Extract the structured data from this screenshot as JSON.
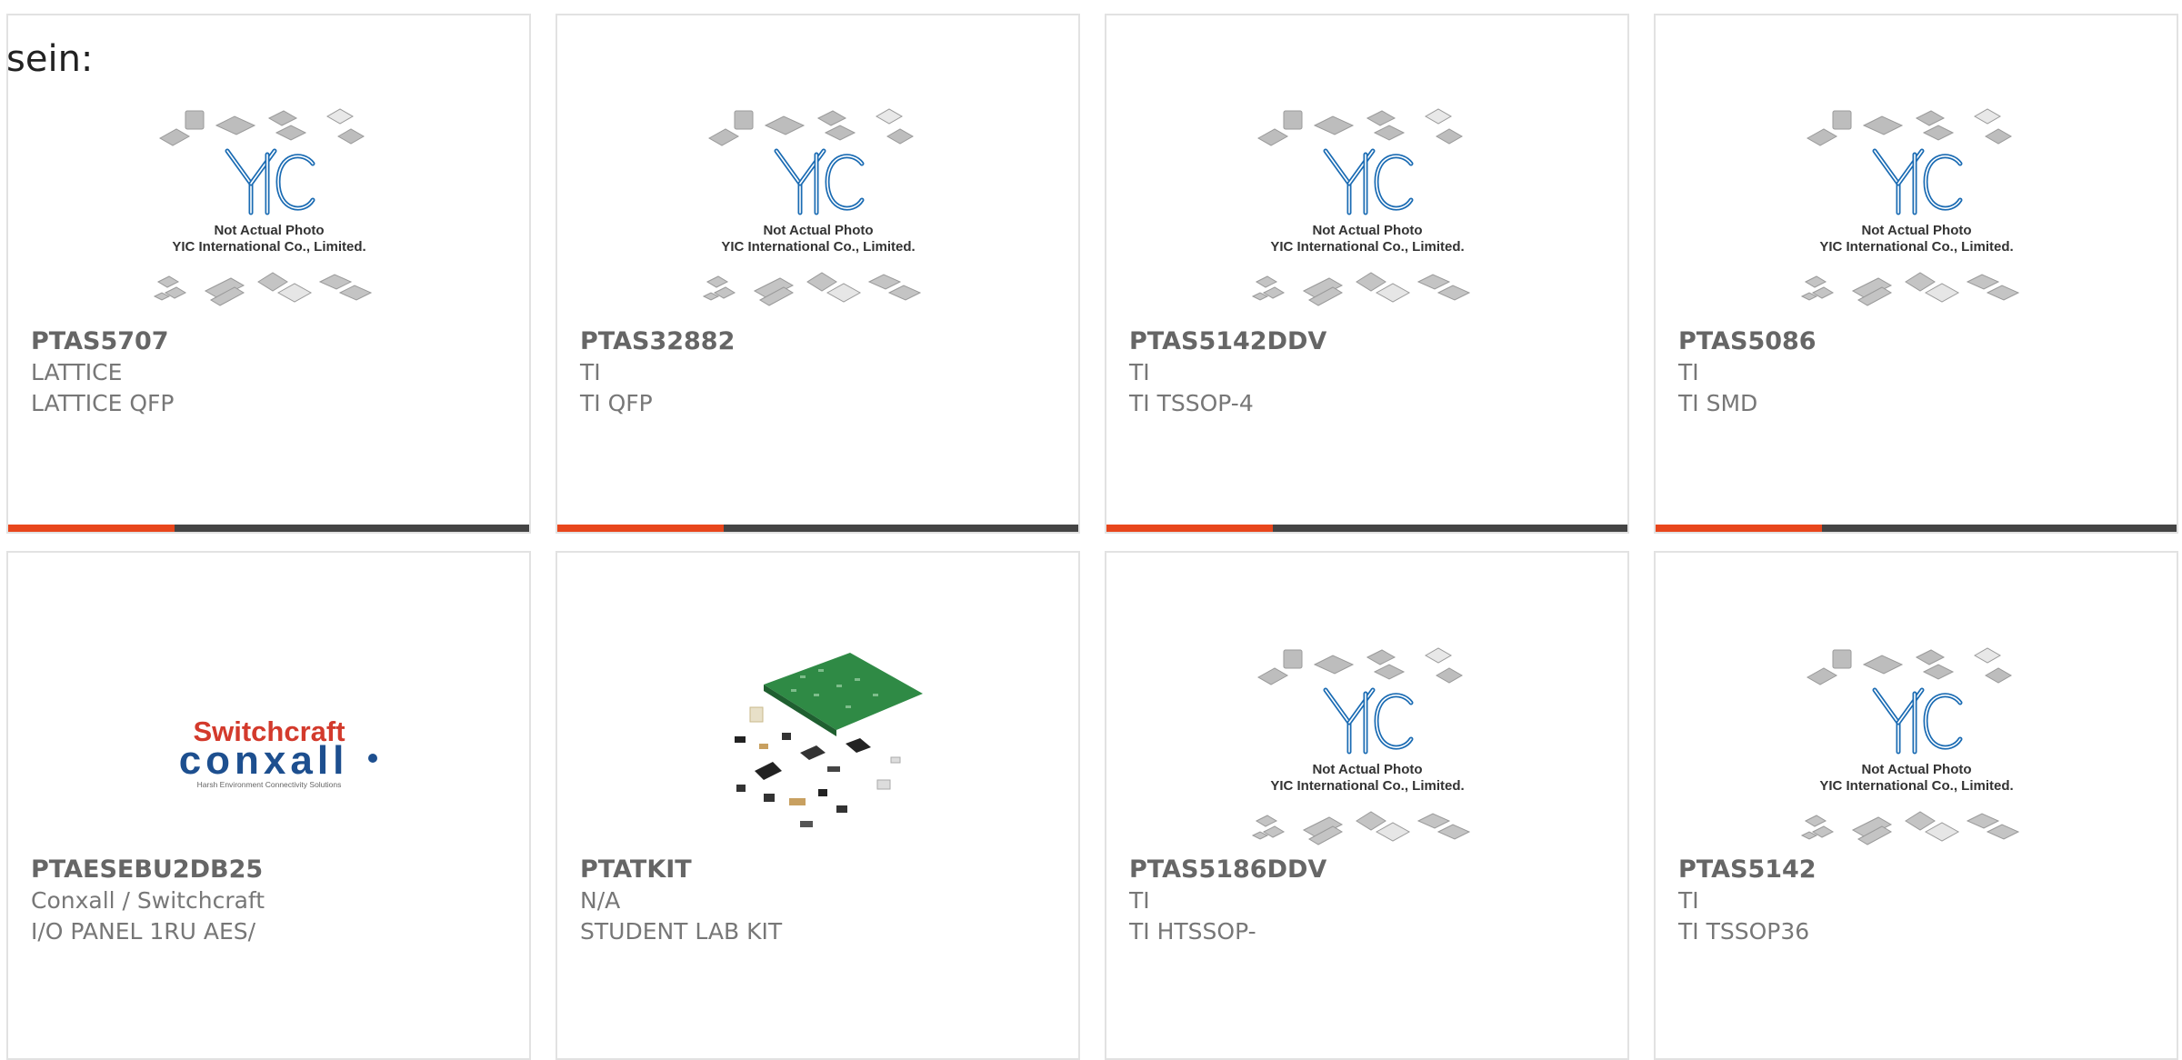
{
  "intro_text": "sein:",
  "placeholder_image": {
    "logo_text": "YIC",
    "line1": "Not Actual Photo",
    "line2": "YIC International Co., Limited."
  },
  "switchcraft_logo": {
    "top": "Switchcraft",
    "bottom": "conxall",
    "tagline": "Harsh Environment Connectivity Solutions"
  },
  "accent_colors": {
    "accent": "#e8461c",
    "bar": "#444444"
  },
  "products": [
    {
      "part": "PTAS5707",
      "manufacturer": "LATTICE",
      "description": "LATTICE QFP",
      "image": "placeholder"
    },
    {
      "part": "PTAS32882",
      "manufacturer": "TI",
      "description": "TI QFP",
      "image": "placeholder"
    },
    {
      "part": "PTAS5142DDV",
      "manufacturer": "TI",
      "description": "TI TSSOP-4",
      "image": "placeholder"
    },
    {
      "part": "PTAS5086",
      "manufacturer": "TI",
      "description": "TI SMD",
      "image": "placeholder"
    },
    {
      "part": "PTAESEBU2DB25",
      "manufacturer": "Conxall / Switchcraft",
      "description": "I/O PANEL 1RU AES/",
      "image": "switchcraft-logo"
    },
    {
      "part": "PTATKIT",
      "manufacturer": "N/A",
      "description": "STUDENT LAB KIT",
      "image": "pcb-kit-photo"
    },
    {
      "part": "PTAS5186DDV",
      "manufacturer": "TI",
      "description": "TI HTSSOP-",
      "image": "placeholder"
    },
    {
      "part": "PTAS5142",
      "manufacturer": "TI",
      "description": "TI TSSOP36",
      "image": "placeholder"
    }
  ]
}
